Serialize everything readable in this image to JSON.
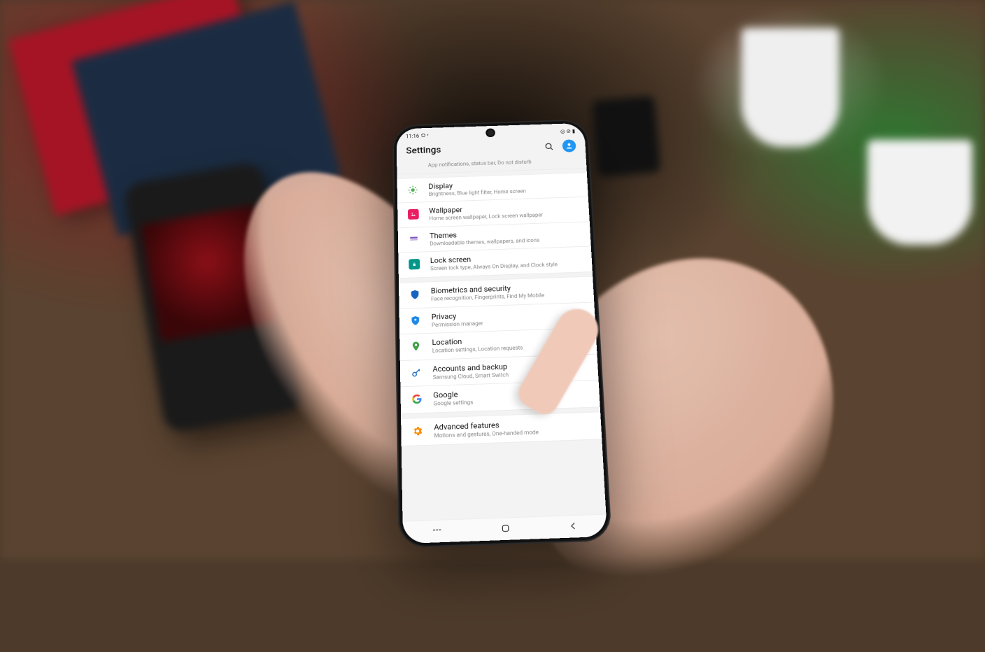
{
  "status_bar": {
    "time": "11:16",
    "left_indicators": "⛭ •",
    "right_indicators": "◎ ⊘ ▮"
  },
  "header": {
    "title": "Settings"
  },
  "partial_top": {
    "subtitle": "App notifications, status bar, Do not disturb"
  },
  "group1": [
    {
      "title": "Display",
      "subtitle": "Brightness, Blue light filter, Home screen",
      "icon_name": "brightness-icon",
      "icon_color": "#4caf50",
      "icon_svg": "sun"
    },
    {
      "title": "Wallpaper",
      "subtitle": "Home screen wallpaper, Lock screen wallpaper",
      "icon_name": "wallpaper-icon",
      "icon_color": "#e91e63",
      "icon_svg": "image"
    },
    {
      "title": "Themes",
      "subtitle": "Downloadable themes, wallpapers, and icons",
      "icon_name": "themes-icon",
      "icon_color": "#7e57c2",
      "icon_svg": "brush"
    },
    {
      "title": "Lock screen",
      "subtitle": "Screen lock type, Always On Display, and Clock style",
      "icon_name": "lock-screen-icon",
      "icon_color": "#009688",
      "icon_svg": "phone-lock"
    }
  ],
  "group2": [
    {
      "title": "Biometrics and security",
      "subtitle": "Face recognition, Fingerprints, Find My Mobile",
      "icon_name": "shield-icon",
      "icon_color": "#1565c0",
      "icon_svg": "shield"
    },
    {
      "title": "Privacy",
      "subtitle": "Permission manager",
      "icon_name": "privacy-icon",
      "icon_color": "#1e88e5",
      "icon_svg": "shield-badge"
    },
    {
      "title": "Location",
      "subtitle": "Location settings, Location requests",
      "icon_name": "location-icon",
      "icon_color": "#43a047",
      "icon_svg": "pin"
    },
    {
      "title": "Accounts and backup",
      "subtitle": "Samsung Cloud, Smart Switch",
      "icon_name": "accounts-icon",
      "icon_color": "#1565c0",
      "icon_svg": "key"
    },
    {
      "title": "Google",
      "subtitle": "Google settings",
      "icon_name": "google-icon",
      "icon_color": "#4285f4",
      "icon_svg": "google"
    }
  ],
  "group3": [
    {
      "title": "Advanced features",
      "subtitle": "Motions and gestures, One-handed mode",
      "icon_name": "advanced-icon",
      "icon_color": "#fb8c00",
      "icon_svg": "gear"
    }
  ]
}
